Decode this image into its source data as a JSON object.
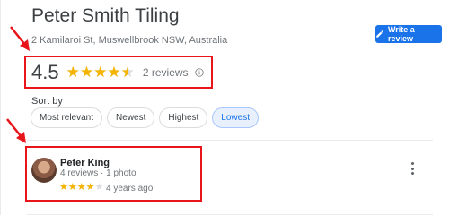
{
  "business": {
    "name": "Peter Smith Tiling",
    "address": "2 Kamilaroi St, Muswellbrook NSW, Australia"
  },
  "toolbar": {
    "write_review_label": "Write a review",
    "write_review_icon": "pencil-icon",
    "accent_color": "#1a73e8"
  },
  "rating": {
    "value": "4.5",
    "stars": 4.5,
    "stars_max": 5,
    "count_label": "2 reviews",
    "info_icon": "info-icon",
    "star_color": "#f4b400"
  },
  "sort": {
    "label": "Sort by",
    "options": [
      "Most relevant",
      "Newest",
      "Highest",
      "Lowest"
    ],
    "selected": "Lowest"
  },
  "review": {
    "reviewer_name": "Peter King",
    "reviews_count": "4 reviews",
    "photos_count": "1 photo",
    "stars": 4,
    "stars_max": 5,
    "age": "4 years ago",
    "menu_icon": "more-vert-icon"
  },
  "annotations": {
    "highlight_color": "#e8161b",
    "arrow_color": "#e8161b"
  }
}
